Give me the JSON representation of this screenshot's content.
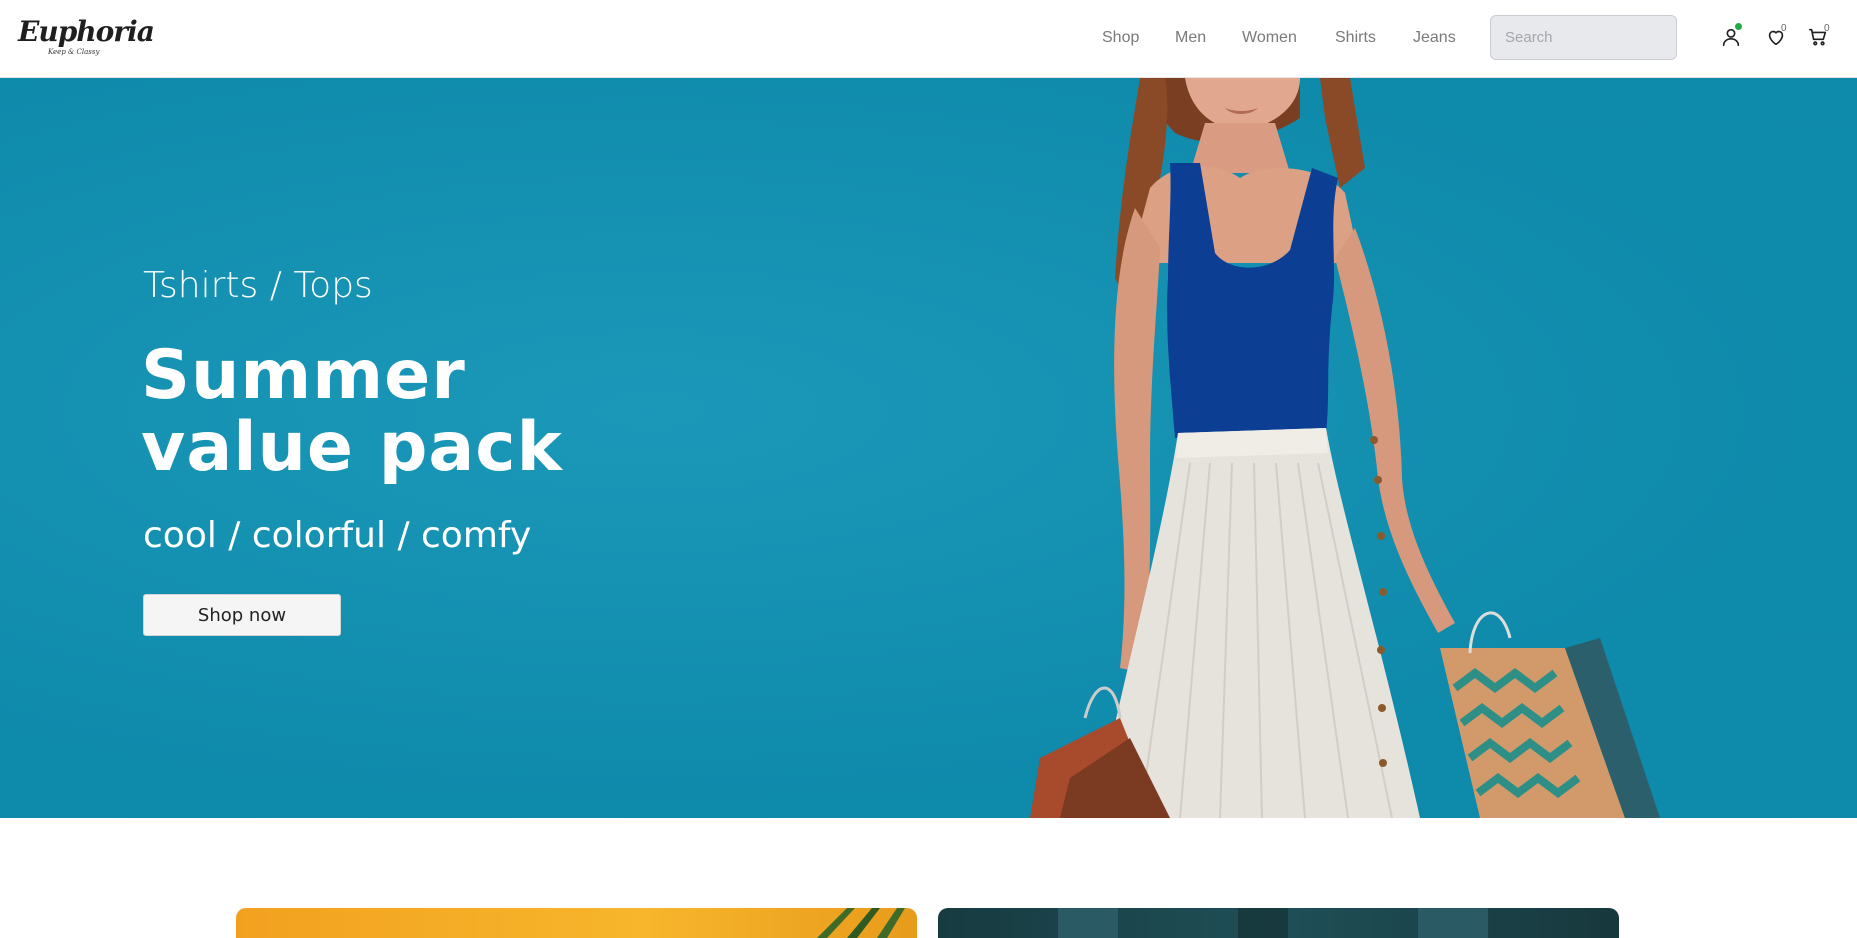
{
  "header": {
    "logo": {
      "name": "Euphoria",
      "tagline": "Keep & Classy"
    },
    "nav": [
      "Shop",
      "Men",
      "Women",
      "Shirts",
      "Jeans"
    ],
    "search": {
      "placeholder": "Search",
      "value": ""
    },
    "icons": {
      "user": "user-icon",
      "wishlist": "heart-icon",
      "cart": "cart-icon",
      "online_indicator_color": "#27a845"
    },
    "wishlist_count": "0",
    "cart_count": "0"
  },
  "hero": {
    "kicker": "Tshirts / Tops",
    "title": "Summer value pack",
    "subtitle": "cool / colorful / comfy",
    "cta_label": "Shop now",
    "background_color": "#0f92b5"
  },
  "colors": {
    "accent": "#0f92b5",
    "card_1": "#f7b62c",
    "card_2": "#1f4f57"
  }
}
